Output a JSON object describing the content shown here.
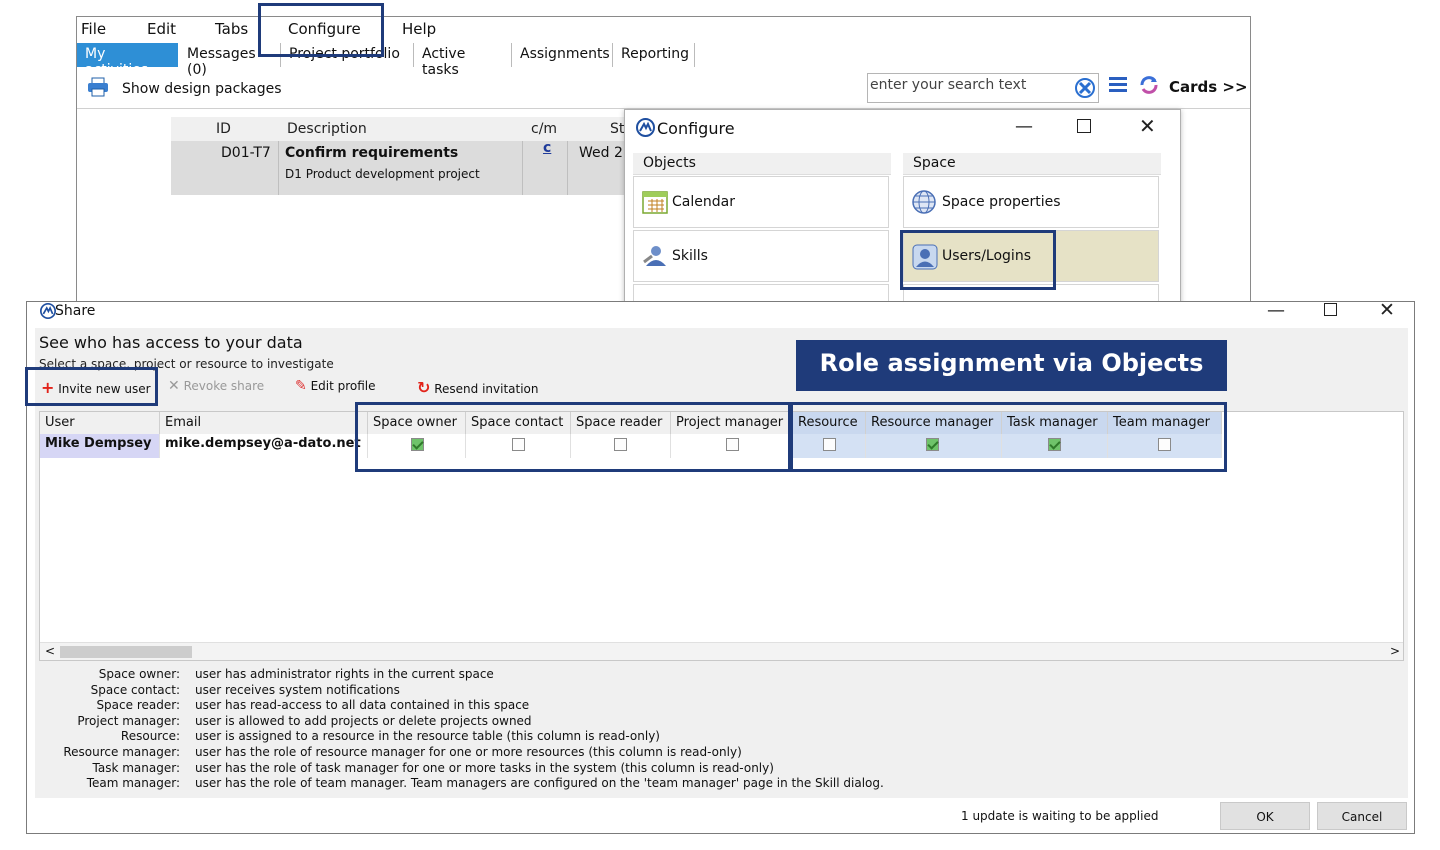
{
  "menubar": {
    "items": [
      "File",
      "Edit",
      "Tabs",
      "Configure",
      "Help"
    ]
  },
  "tabs": [
    {
      "label": "My activities",
      "active": true
    },
    {
      "label": "Messages (0)",
      "active": false
    },
    {
      "label": "Project portfolio",
      "active": false
    },
    {
      "label": "Active tasks",
      "active": false
    },
    {
      "label": "Assignments",
      "active": false
    },
    {
      "label": "Reporting",
      "active": false
    }
  ],
  "toolbar": {
    "show_design_packages": "Show design packages",
    "search_placeholder": "enter your search text",
    "cards_link": "Cards >>"
  },
  "grid": {
    "headers": {
      "id": "ID",
      "description": "Description",
      "cm": "c/m",
      "st": "St"
    },
    "row": {
      "id": "D01-T7",
      "title": "Confirm requirements",
      "subtitle": "D1 Product development project",
      "cm": "c",
      "date": "Wed 2"
    }
  },
  "configure_dialog": {
    "title": "Configure",
    "objects_section": "Objects",
    "space_section": "Space",
    "objects_items": [
      "Calendar",
      "Skills"
    ],
    "space_items": [
      "Space properties",
      "Users/Logins"
    ],
    "selected_item": "Users/Logins"
  },
  "share_dialog": {
    "title": "Share",
    "heading": "See who has access to your data",
    "hint": "Select a space, project or resource to investigate",
    "tools": {
      "invite": "Invite new user",
      "revoke": "Revoke share",
      "edit": "Edit profile",
      "resend": "Resend invitation"
    },
    "columns": {
      "user": "User",
      "email": "Email",
      "space_owner": "Space owner",
      "space_contact": "Space contact",
      "space_reader": "Space reader",
      "project_manager": "Project manager",
      "resource": "Resource",
      "resource_manager": "Resource manager",
      "task_manager": "Task manager",
      "team_manager": "Team manager"
    },
    "row": {
      "user": "Mike Dempsey",
      "email": "mike.dempsey@a-dato.net",
      "space_owner": true,
      "space_contact": false,
      "space_reader": false,
      "project_manager": false,
      "resource": false,
      "resource_manager": true,
      "task_manager": true,
      "team_manager": false
    },
    "scroll": {
      "left": "<",
      "right": ">"
    },
    "legend": [
      {
        "key": "Space owner:",
        "value": "user has administrator rights in the current space"
      },
      {
        "key": "Space contact:",
        "value": "user receives system notifications"
      },
      {
        "key": "Space reader:",
        "value": "user has read-access to all data contained in this space"
      },
      {
        "key": "Project manager:",
        "value": "user is allowed to add projects or delete projects owned"
      },
      {
        "key": "Resource:",
        "value": "user is assigned to a resource in the resource table (this column is read-only)"
      },
      {
        "key": "Resource manager:",
        "value": "user has the role of resource manager for one or more resources (this column is read-only)"
      },
      {
        "key": "Task manager:",
        "value": "user has the role of task manager for one or more tasks in the system (this column is read-only)"
      },
      {
        "key": "Team manager:",
        "value": "user has the role of team manager. Team managers are configured on the 'team manager' page in the Skill dialog."
      }
    ],
    "status": "1 update is waiting to be applied",
    "ok_label": "OK",
    "cancel_label": "Cancel"
  },
  "annotation": {
    "banner": "Role assignment via Objects"
  },
  "colors": {
    "accent_tab": "#2e8fd6",
    "highlight": "#1f3b7a",
    "role_columns": "#c9d8ef",
    "checked": "#6fc36a"
  }
}
